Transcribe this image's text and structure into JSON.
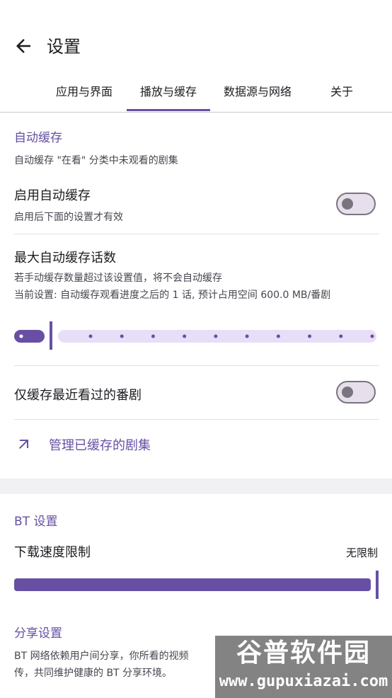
{
  "header": {
    "title": "设置"
  },
  "tabs": [
    {
      "label": "应用与界面",
      "active": false
    },
    {
      "label": "播放与缓存",
      "active": true
    },
    {
      "label": "数据源与网络",
      "active": false
    },
    {
      "label": "关于",
      "active": false
    }
  ],
  "auto_cache": {
    "section_title": "自动缓存",
    "section_desc": "自动缓存 \"在看\" 分类中未观看的剧集",
    "enable": {
      "label": "启用自动缓存",
      "desc": "启用后下面的设置才有效",
      "checked": false
    },
    "max_episodes": {
      "label": "最大自动缓存话数",
      "desc_line1": "若手动缓存数量超过该设置值，将不会自动缓存",
      "desc_line2": "当前设置: 自动缓存观看进度之后的 1 话, 预计占用空间 600.0 MB/番剧",
      "value": 1,
      "steps": 10
    },
    "recent_only": {
      "label": "仅缓存最近看过的番剧",
      "checked": false
    },
    "manage_link": {
      "label": "管理已缓存的剧集"
    }
  },
  "bt": {
    "section_title": "BT 设置",
    "speed_limit": {
      "label": "下载速度限制",
      "value_text": "无限制",
      "fraction": 1.0
    },
    "share": {
      "title": "分享设置",
      "desc_line1": "BT 网络依赖用户间分享，你所看的视频",
      "desc_line2": "传，共同维护健康的 BT 分享环境。"
    }
  },
  "watermark": {
    "line1": "谷普软件园",
    "line2": "www.gupuxiazai.com"
  },
  "colors": {
    "accent": "#6750a4",
    "track": "#e8def8",
    "outline": "#79747e"
  }
}
